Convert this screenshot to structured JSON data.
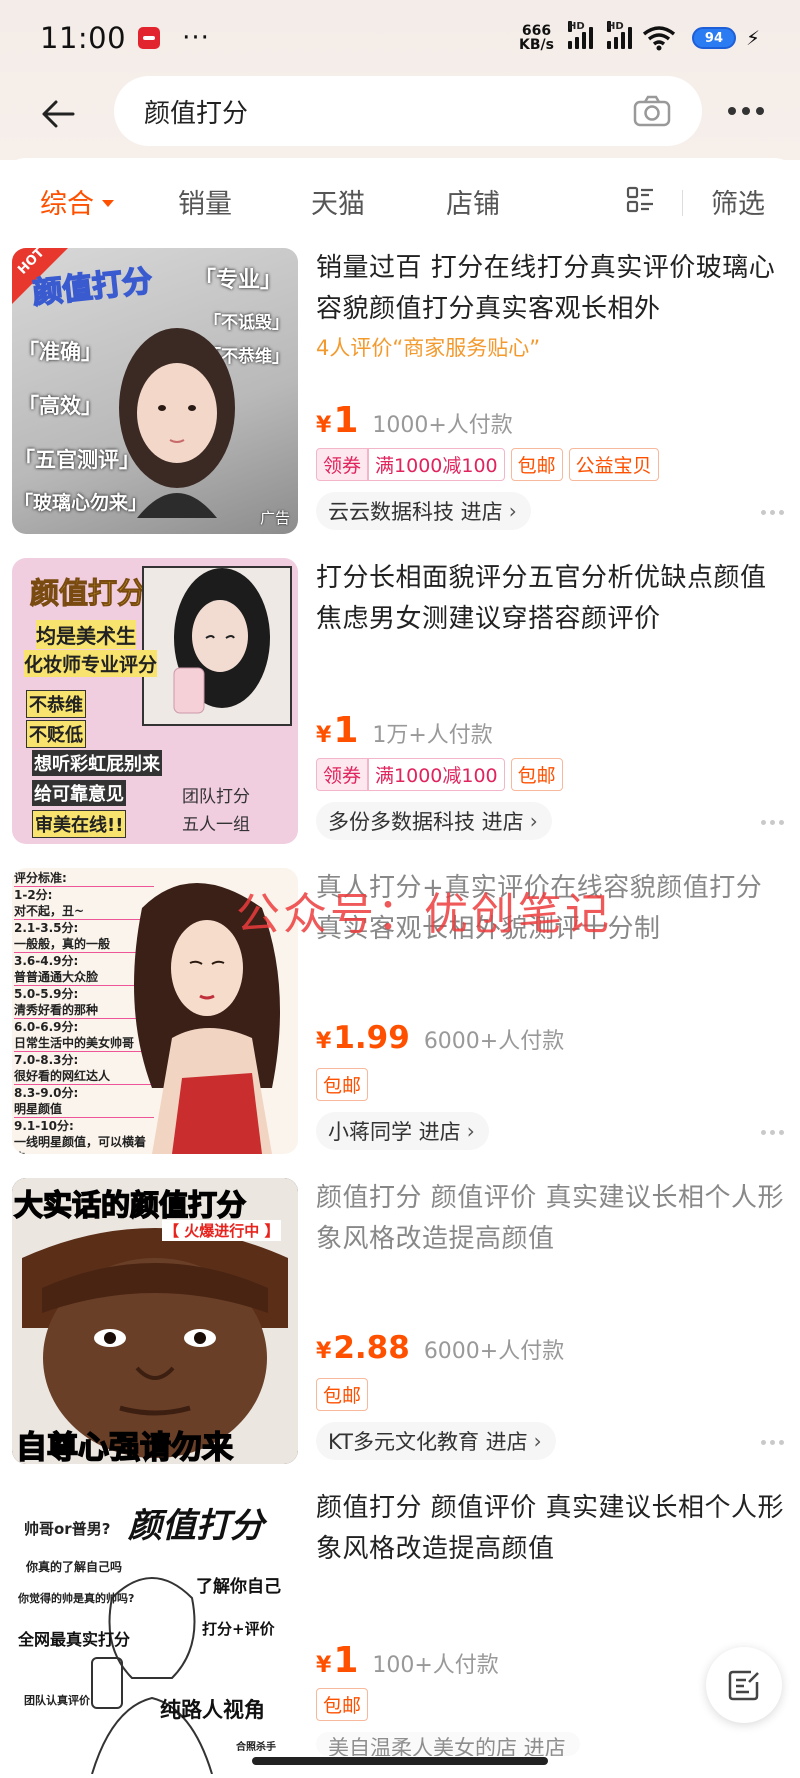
{
  "status_bar": {
    "time": "11:00",
    "dots": "···",
    "net_speed_value": "666",
    "net_speed_unit": "KB/s",
    "hd1": "HD",
    "hd2": "HD",
    "battery": "94"
  },
  "search": {
    "query": "颜值打分"
  },
  "tabs": {
    "comprehensive": "综合",
    "sales": "销量",
    "tmall": "天猫",
    "stores": "店铺",
    "filter": "筛选"
  },
  "products": [
    {
      "title": "销量过百 打分在线打分真实评价玻璃心容貌颜值打分真实客观长相外",
      "subtitle": "4人评价“商家服务贴心”",
      "currency": "¥",
      "price": "1",
      "sales": "1000+人付款",
      "tags": [
        "领券",
        "满1000减100",
        "包邮",
        "公益宝贝"
      ],
      "shop": "云云数据科技 进店",
      "ad_label": "广告",
      "thumb": {
        "hot": "HOT",
        "headline": "颜值打分",
        "l1": "「专业」",
        "l2": "「不诋毁」",
        "l3": "「不恭维」",
        "l4": "「准确」",
        "l5": "「高效」",
        "l6": "「五官测评」",
        "l7": "「玻璃心勿来」"
      }
    },
    {
      "title": "打分长相面貌评分五官分析优缺点颜值焦虑男女测建议穿搭容颜评价",
      "currency": "¥",
      "price": "1",
      "sales": "1万+人付款",
      "tags": [
        "领券",
        "满1000减100",
        "包邮"
      ],
      "shop": "多份多数据科技 进店",
      "thumb": {
        "headline": "颜值打分",
        "l1": "均是美术生",
        "l2": "化妆师专业评分",
        "l3": "不恭维",
        "l4": "不贬低",
        "l5": "想听彩虹屁别来",
        "l6": "给可靠意见",
        "l7": "审美在线!!",
        "l8": "团队打分",
        "l9": "五人一组"
      }
    },
    {
      "title": "真人打分+真实评价在线容貌颜值打分真实客观长相外貌测评十分制",
      "currency": "¥",
      "price": "1.99",
      "sales": "6000+人付款",
      "tags": [
        "包邮"
      ],
      "shop": "小蒋同学 进店",
      "thumb": {
        "lines": [
          "评分标准:",
          "1-2分:",
          "对不起，丑~",
          "2.1-3.5分:",
          "一般般，真的一般",
          "3.6-4.9分:",
          "普普通通大众脸",
          "5.0-5.9分:",
          "清秀好看的那种",
          "6.0-6.9分:",
          "日常生活中的美女帅哥",
          "7.0-8.3分:",
          "很好看的网红达人",
          "8.3-9.0分:",
          "明星颜值",
          "9.1-10分:",
          "一线明星颜值，可以横着走"
        ]
      }
    },
    {
      "title": "颜值打分 颜值评价 真实建议长相个人形象风格改造提高颜值",
      "currency": "¥",
      "price": "2.88",
      "sales": "6000+人付款",
      "tags": [
        "包邮"
      ],
      "shop": "KT多元文化教育 进店",
      "thumb": {
        "top": "大实话的颜值打分",
        "badge": "【 火爆进行中 】",
        "bottom": "自尊心强请勿来"
      }
    },
    {
      "title": "颜值打分 颜值评价 真实建议长相个人形象风格改造提高颜值",
      "currency": "¥",
      "price": "1",
      "sales": "100+人付款",
      "tags": [
        "包邮"
      ],
      "shop": "美自温柔人美女的店 进店",
      "thumb": {
        "l1": "帅哥or普男?",
        "headline": "颜值打分",
        "l2": "你真的了解自己吗",
        "l3": "了解你自己",
        "l4": "你觉得的帅是真的帅吗?",
        "l5": "全网最真实打分",
        "l6": "打分+评价",
        "l7": "团队认真评价",
        "l8": "纯路人视角",
        "l9": "合照杀手"
      }
    }
  ],
  "watermark": "公众号：优创笔记",
  "colors": {
    "accent": "#ff5000",
    "coupon": "#e0245e",
    "subtitle": "#f39a2e"
  }
}
